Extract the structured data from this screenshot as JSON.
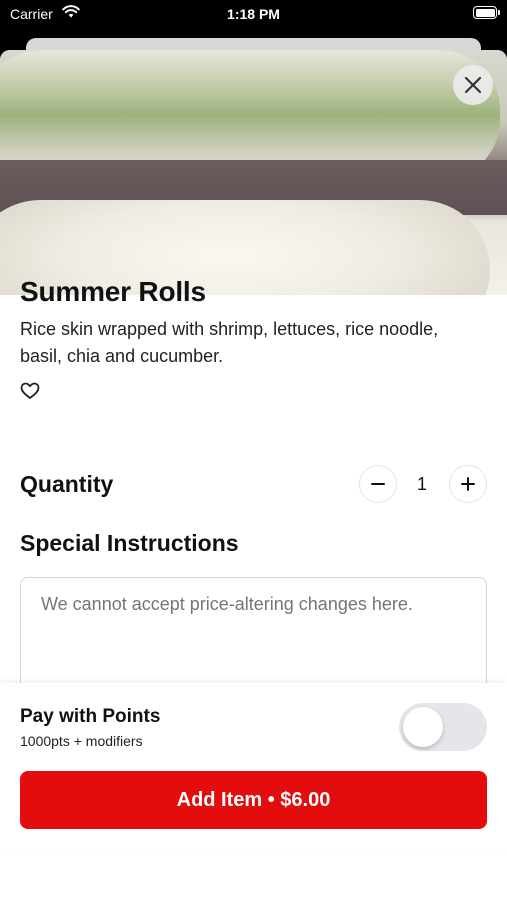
{
  "status_bar": {
    "carrier": "Carrier",
    "time": "1:18 PM"
  },
  "item": {
    "title": "Summer Rolls",
    "description": "Rice skin wrapped with shrimp, lettuces, rice noodle, basil, chia and cucumber."
  },
  "quantity": {
    "label": "Quantity",
    "value": "1"
  },
  "special_instructions": {
    "label": "Special Instructions",
    "placeholder": "We cannot accept price-altering changes here."
  },
  "points": {
    "title": "Pay with Points",
    "subtitle": "1000pts + modifiers",
    "enabled": false
  },
  "add_button": {
    "label": "Add Item • $6.00"
  },
  "colors": {
    "accent": "#e30d0d"
  },
  "icons": {
    "close": "close-icon",
    "favorite": "heart-icon",
    "minus": "minus-icon",
    "plus": "plus-icon"
  }
}
